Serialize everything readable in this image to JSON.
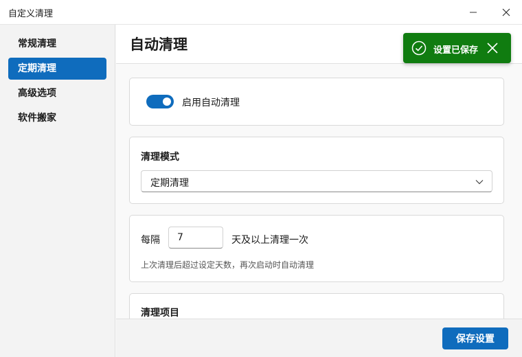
{
  "window": {
    "title": "自定义清理"
  },
  "sidebar": {
    "items": [
      {
        "label": "常规清理",
        "active": false
      },
      {
        "label": "定期清理",
        "active": true
      },
      {
        "label": "高级选项",
        "active": false
      },
      {
        "label": "软件搬家",
        "active": false
      }
    ]
  },
  "page": {
    "title": "自动清理"
  },
  "auto_clean": {
    "enabled": true,
    "label": "启用自动清理"
  },
  "mode": {
    "label": "清理模式",
    "selected": "定期清理"
  },
  "interval": {
    "prefix": "每隔",
    "value": "7",
    "suffix": "天及以上清理一次",
    "hint": "上次清理后超过设定天数，再次启动时自动清理"
  },
  "items_section": {
    "label": "清理项目"
  },
  "footer": {
    "save_label": "保存设置"
  },
  "toast": {
    "message": "设置已保存"
  },
  "colors": {
    "accent": "#0f6cbd",
    "success": "#107c10"
  }
}
